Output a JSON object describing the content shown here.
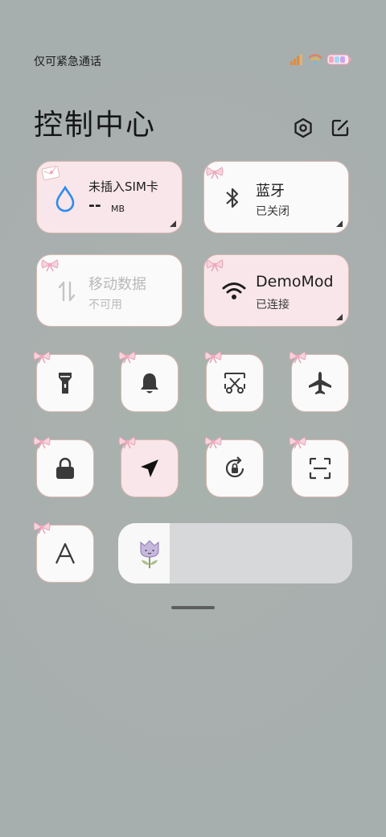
{
  "status_bar": {
    "carrier_text": "仅可紧急通话",
    "icons": [
      "signal-icon",
      "wifi-icon",
      "battery-icon"
    ]
  },
  "header": {
    "title": "控制中心",
    "settings_icon": "settings-hex-icon",
    "edit_icon": "edit-icon"
  },
  "cards": {
    "sim": {
      "title": "未插入SIM卡",
      "value": "--",
      "unit": "MB"
    },
    "bluetooth": {
      "title": "蓝牙",
      "status": "已关闭"
    },
    "mobile_data": {
      "title": "移动数据",
      "status": "不可用"
    },
    "wifi": {
      "title": "DemoMod",
      "status": "已连接"
    }
  },
  "toggles": [
    {
      "name": "flashlight",
      "icon": "flashlight-icon",
      "active": false
    },
    {
      "name": "silent",
      "icon": "bell-icon",
      "active": false
    },
    {
      "name": "screenshot",
      "icon": "scissors-screenshot-icon",
      "active": false
    },
    {
      "name": "airplane",
      "icon": "airplane-icon",
      "active": false
    },
    {
      "name": "lock",
      "icon": "lock-icon",
      "active": false
    },
    {
      "name": "location",
      "icon": "location-arrow-icon",
      "active": true
    },
    {
      "name": "rotation-lock",
      "icon": "rotation-lock-icon",
      "active": false
    },
    {
      "name": "scanner",
      "icon": "scan-icon",
      "active": false
    },
    {
      "name": "font-size",
      "icon": "font-a-icon",
      "active": false
    }
  ],
  "brightness": {
    "level": 0.22,
    "icon": "tulip-icon"
  },
  "colors": {
    "pink_tile": "#f9e6ea",
    "white_tile": "#fafafa",
    "accent_blue": "#2d8cf0",
    "border": "#d8b8b0"
  }
}
